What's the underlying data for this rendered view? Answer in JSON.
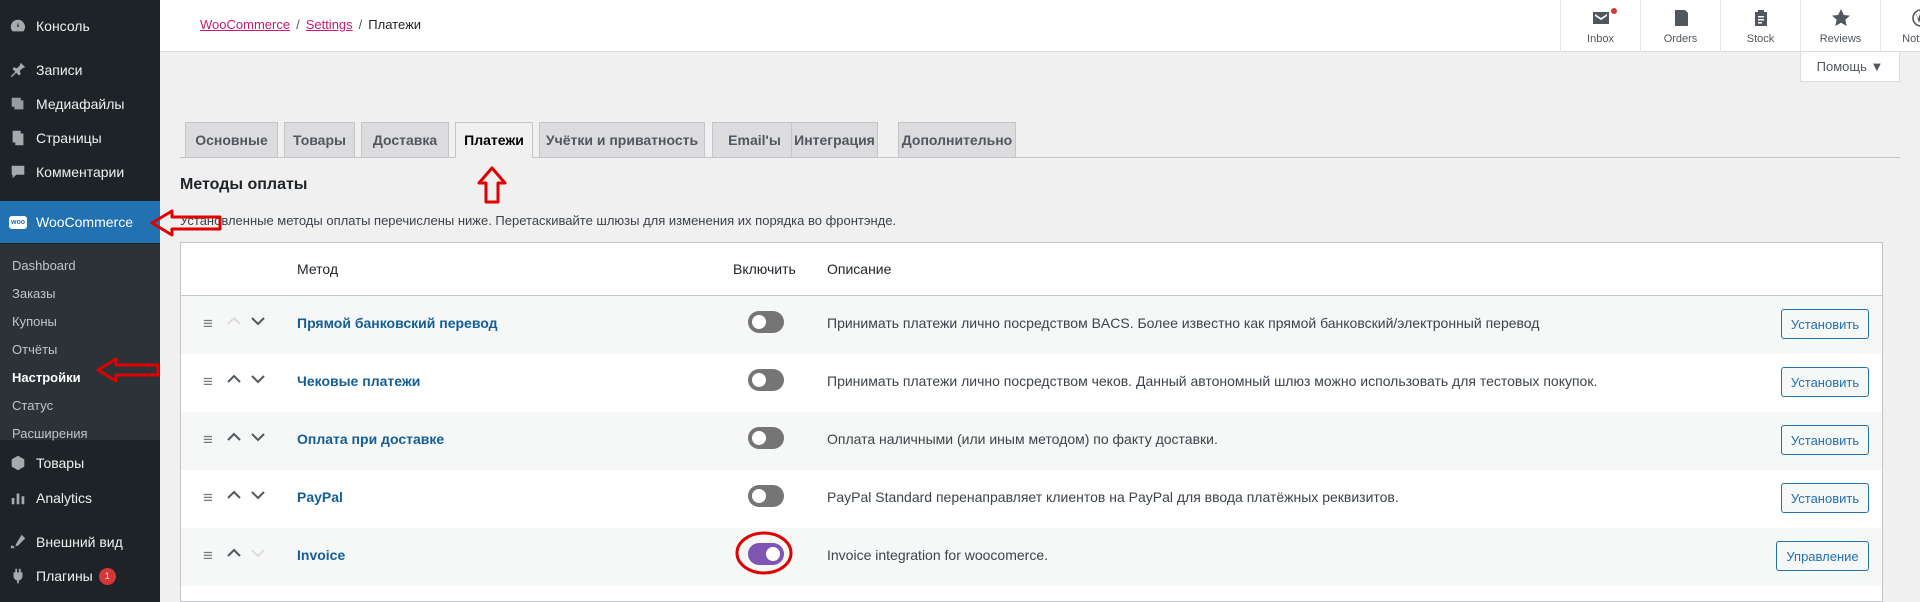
{
  "sidebar": {
    "items": [
      {
        "label": "Консоль",
        "icon": "dashboard-icon"
      },
      {
        "label": "Записи",
        "icon": "pin-icon"
      },
      {
        "label": "Медиафайлы",
        "icon": "media-icon"
      },
      {
        "label": "Страницы",
        "icon": "pages-icon"
      },
      {
        "label": "Комментарии",
        "icon": "comments-icon"
      },
      {
        "label": "WooCommerce",
        "icon": "woocommerce-icon"
      },
      {
        "label": "Товары",
        "icon": "products-icon"
      },
      {
        "label": "Analytics",
        "icon": "analytics-icon"
      },
      {
        "label": "Внешний вид",
        "icon": "appearance-icon"
      },
      {
        "label": "Плагины",
        "icon": "plugins-icon",
        "badge": "1"
      }
    ],
    "submenu": [
      "Dashboard",
      "Заказы",
      "Купоны",
      "Отчёты",
      "Настройки",
      "Статус",
      "Расширения"
    ]
  },
  "header": {
    "breadcrumb": {
      "link1": "WooCommerce",
      "link2": "Settings",
      "current": "Платежи",
      "separator": "/"
    },
    "toolbar": [
      {
        "label": "Inbox",
        "icon": "inbox-icon"
      },
      {
        "label": "Orders",
        "icon": "orders-icon"
      },
      {
        "label": "Stock",
        "icon": "stock-icon"
      },
      {
        "label": "Reviews",
        "icon": "star-icon"
      },
      {
        "label": "Notices",
        "icon": "wordpress-icon"
      }
    ],
    "help_label": "Помощь ▼"
  },
  "tabs": [
    "Основные",
    "Товары",
    "Доставка",
    "Платежи",
    "Учётки и приватность",
    "Email'ы",
    "Интеграция",
    "Дополнительно"
  ],
  "active_tab": "Платежи",
  "section": {
    "title": "Методы оплаты",
    "description": "Установленные методы оплаты перечислены ниже. Перетаскивайте шлюзы для изменения их порядка во фронтэнде."
  },
  "table": {
    "headers": {
      "method": "Метод",
      "enable": "Включить",
      "description": "Описание"
    },
    "rows": [
      {
        "name": "Прямой банковский перевод",
        "enabled": false,
        "description": "Принимать платежи лично посредством BACS. Более известно как прямой банковский/электронный перевод",
        "action": "Установить",
        "up_enabled": false,
        "down_enabled": true
      },
      {
        "name": "Чековые платежи",
        "enabled": false,
        "description": "Принимать платежи лично посредством чеков. Данный автономный шлюз можно использовать для тестовых покупок.",
        "action": "Установить",
        "up_enabled": true,
        "down_enabled": true
      },
      {
        "name": "Оплата при доставке",
        "enabled": false,
        "description": "Оплата наличными (или иным методом) по факту доставки.",
        "action": "Установить",
        "up_enabled": true,
        "down_enabled": true
      },
      {
        "name": "PayPal",
        "enabled": false,
        "description": "PayPal Standard перенаправляет клиентов на PayPal для ввода платёжных реквизитов.",
        "action": "Установить",
        "up_enabled": true,
        "down_enabled": true
      },
      {
        "name": "Invoice",
        "enabled": true,
        "description": "Invoice integration for woocomerce.",
        "action": "Управление",
        "up_enabled": true,
        "down_enabled": false
      }
    ]
  },
  "colors": {
    "accent": "#2271b1",
    "woo_purple": "#7f54b3",
    "annotation_red": "#e00000"
  }
}
